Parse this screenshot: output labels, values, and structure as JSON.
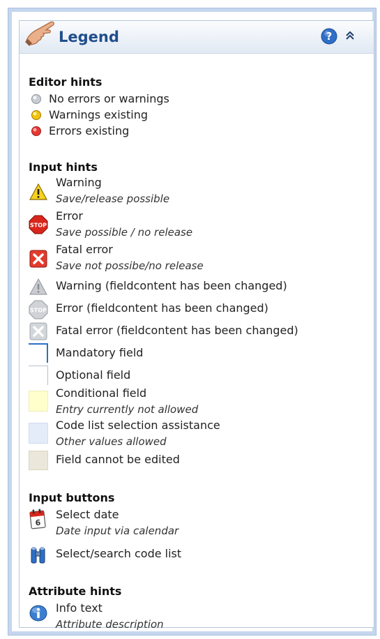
{
  "header": {
    "title": "Legend"
  },
  "editor_hints": {
    "title": "Editor hints",
    "items": [
      {
        "label": "No errors or warnings",
        "icon": "grey-dot-icon",
        "color": "#bfc5cc"
      },
      {
        "label": "Warnings existing",
        "icon": "yellow-dot-icon",
        "color": "#f1c40f"
      },
      {
        "label": "Errors existing",
        "icon": "red-dot-icon",
        "color": "#e53935"
      }
    ]
  },
  "input_hints": {
    "title": "Input hints",
    "items": [
      {
        "label": "Warning",
        "sub": "Save/release possible",
        "icon": "warning-icon"
      },
      {
        "label": "Error",
        "sub": "Save possible / no release",
        "icon": "stop-icon"
      },
      {
        "label": "Fatal error",
        "sub": "Save not possibe/no release",
        "icon": "fatal-error-icon"
      },
      {
        "label": "Warning (fieldcontent has been changed)",
        "icon": "warning-grey-icon"
      },
      {
        "label": "Error (fieldcontent has been changed)",
        "icon": "stop-grey-icon"
      },
      {
        "label": "Fatal error (fieldcontent has been changed)",
        "icon": "fatal-error-grey-icon"
      },
      {
        "label": "Mandatory field",
        "icon": "mandatory-field-swatch"
      },
      {
        "label": "Optional field",
        "icon": "optional-field-swatch"
      },
      {
        "label": "Conditional field",
        "sub": "Entry currently not allowed",
        "icon": "conditional-field-swatch",
        "color": "#ffffcc"
      },
      {
        "label": "Code list selection assistance",
        "sub": "Other values allowed",
        "icon": "code-list-field-swatch",
        "color": "#e3ecf8"
      },
      {
        "label": "Field cannot be edited",
        "icon": "readonly-field-swatch",
        "color": "#ebe7da"
      }
    ]
  },
  "input_buttons": {
    "title": "Input buttons",
    "items": [
      {
        "label": "Select date",
        "sub": "Date input via calendar",
        "icon": "calendar-icon"
      },
      {
        "label": "Select/search code list",
        "icon": "binoculars-icon"
      }
    ]
  },
  "attribute_hints": {
    "title": "Attribute hints",
    "items": [
      {
        "label": "Info text",
        "sub": "Attribute description",
        "icon": "info-icon"
      }
    ]
  }
}
